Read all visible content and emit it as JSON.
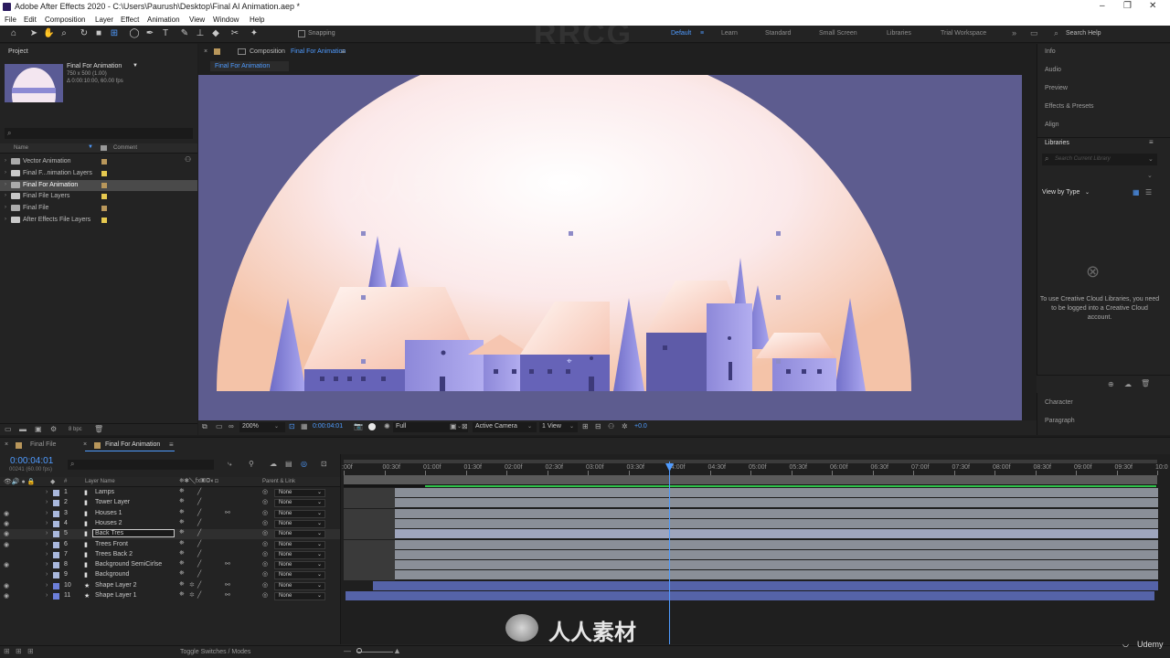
{
  "titlebar": {
    "title": "Adobe After Effects 2020 - C:\\Users\\Paurush\\Desktop\\Final AI Animation.aep *"
  },
  "menu": [
    "File",
    "Edit",
    "Composition",
    "Layer",
    "Effect",
    "Animation",
    "View",
    "Window",
    "Help"
  ],
  "toolbar": {
    "snapping": "Snapping",
    "workspaces": [
      "Default",
      "Learn",
      "Standard",
      "Small Screen",
      "Libraries",
      "Trial Workspace"
    ],
    "search": "Search Help"
  },
  "project": {
    "title": "Project",
    "comp_name": "Final For Animation",
    "comp_size": "750 x 500 (1.00)",
    "comp_dur": "Δ 0:00:10:00, 60.00 fps",
    "col_name": "Name",
    "col_comment": "Comment",
    "bpc": "8 bpc",
    "items": [
      {
        "label": "Vector Animation",
        "color": "#b9975b",
        "type": "comp"
      },
      {
        "label": "Final F...nimation Layers",
        "color": "#e6c94f",
        "type": "folder"
      },
      {
        "label": "Final For Animation",
        "color": "#b9975b",
        "type": "comp"
      },
      {
        "label": "Final File Layers",
        "color": "#e6c94f",
        "type": "folder"
      },
      {
        "label": "Final File",
        "color": "#b9975b",
        "type": "comp"
      },
      {
        "label": "After Effects File Layers",
        "color": "#e6c94f",
        "type": "folder"
      }
    ]
  },
  "comp": {
    "header": "Composition",
    "header_name": "Final For Animation",
    "tab": "Final For Animation",
    "zoom": "200%",
    "time": "0:00:04:01",
    "res": "Full",
    "camera": "Active Camera",
    "view": "1 View",
    "exposure": "+0.0"
  },
  "right": {
    "items": [
      "Info",
      "Audio",
      "Preview",
      "Effects & Presets",
      "Align"
    ],
    "libraries": "Libraries",
    "lib_search": "Search Current Library",
    "view_by": "View by Type",
    "cc_msg": "To use Creative Cloud Libraries, you need to be logged into a Creative Cloud account.",
    "character": "Character",
    "paragraph": "Paragraph"
  },
  "timeline": {
    "tabs": [
      "Final File",
      "Final For Animation"
    ],
    "timecode": "0:00:04:01",
    "frames": "00241 (60.00 fps)",
    "col_layer": "Layer Name",
    "col_parent": "Parent & Link",
    "footer": "Toggle Switches / Modes",
    "ticks": [
      ":00f",
      "00:30f",
      "01:00f",
      "01:30f",
      "02:00f",
      "02:30f",
      "03:00f",
      "03:30f",
      "04:00f",
      "04:30f",
      "05:00f",
      "05:30f",
      "06:00f",
      "06:30f",
      "07:00f",
      "07:30f",
      "08:00f",
      "08:30f",
      "09:00f",
      "09:30f",
      "10:0"
    ],
    "layers": [
      {
        "num": "1",
        "name": "Lamps",
        "parent": "None"
      },
      {
        "num": "2",
        "name": "Tower Layer",
        "parent": "None"
      },
      {
        "num": "3",
        "name": "Houses 1",
        "parent": "None"
      },
      {
        "num": "4",
        "name": "Houses 2",
        "parent": "None"
      },
      {
        "num": "5",
        "name": "Back Tres",
        "parent": "None"
      },
      {
        "num": "6",
        "name": "Trees Front",
        "parent": "None"
      },
      {
        "num": "7",
        "name": "Trees Back 2",
        "parent": "None"
      },
      {
        "num": "8",
        "name": "Background SemiCirlse",
        "parent": "None"
      },
      {
        "num": "9",
        "name": "Background",
        "parent": "None"
      },
      {
        "num": "10",
        "name": "Shape Layer 2",
        "parent": "None"
      },
      {
        "num": "11",
        "name": "Shape Layer 1",
        "parent": "None"
      }
    ]
  },
  "watermark": {
    "brand": "RRCG",
    "cn": "人人素材",
    "udemy": "Udemy"
  }
}
